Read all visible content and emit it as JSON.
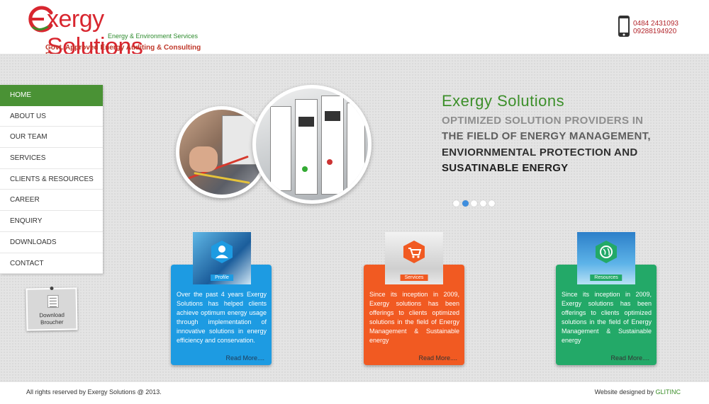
{
  "brand": {
    "name": "xergy Solutions",
    "tagline": "Energy & Environment Services",
    "subtitle": "Govt. Approved Energy Auditing & Consulting Firm",
    "colors": {
      "red": "#d8262f",
      "green": "#3c8f2a"
    }
  },
  "contact": {
    "icon": "mobile-phone-icon",
    "phone1": "0484 2431093",
    "phone2": "09288194920"
  },
  "nav": {
    "items": [
      {
        "label": "HOME",
        "active": true
      },
      {
        "label": "ABOUT US"
      },
      {
        "label": "OUR TEAM"
      },
      {
        "label": "SERVICES"
      },
      {
        "label": "CLIENTS & RESOURCES"
      },
      {
        "label": "CAREER"
      },
      {
        "label": "ENQUIRY"
      },
      {
        "label": "DOWNLOADS"
      },
      {
        "label": "CONTACT"
      }
    ],
    "active_color": "#4a9235"
  },
  "brochure": {
    "label_line1": "Download",
    "label_line2": "Broucher",
    "icon": "document-icon"
  },
  "hero": {
    "title": "Exergy Solutions",
    "line1": "OPTIMIZED SOLUTION PROVIDERS IN",
    "line2": "THE FIELD OF ENERGY MANAGEMENT,",
    "line3": "ENVIORNMENTAL PROTECTION AND",
    "line4": "SUSATINABLE ENERGY",
    "slides_total": 5,
    "slide_active": 2
  },
  "cards": [
    {
      "badge": "Profile",
      "icon": "user-icon",
      "text": "Over the past 4 years Exergy Solutions has helped clients achieve optimum energy usage through implementation of innovative solutions in energy efficiency and conservation.",
      "more": "Read More....",
      "color": "#1d9be2"
    },
    {
      "badge": "Services",
      "icon": "shopping-cart-icon",
      "text": "Since its inception in 2009, Exergy solutions has been offerings to clients optimized solutions in the field of Energy Management & Sustainable energy",
      "more": "Read More....",
      "color": "#f15a22"
    },
    {
      "badge": "Resources",
      "icon": "globe-icon",
      "text": "Since its inception in 2009, Exergy solutions has been offerings to clients optimized solutions in the field of Energy Management & Sustainable energy",
      "more": "Read More....",
      "color": "#23a968"
    }
  ],
  "footer": {
    "copyright": "All rights reserved by Exergy Solutions @ 2013.",
    "designed_by": "Website designed by ",
    "designer": "GLITINC"
  }
}
